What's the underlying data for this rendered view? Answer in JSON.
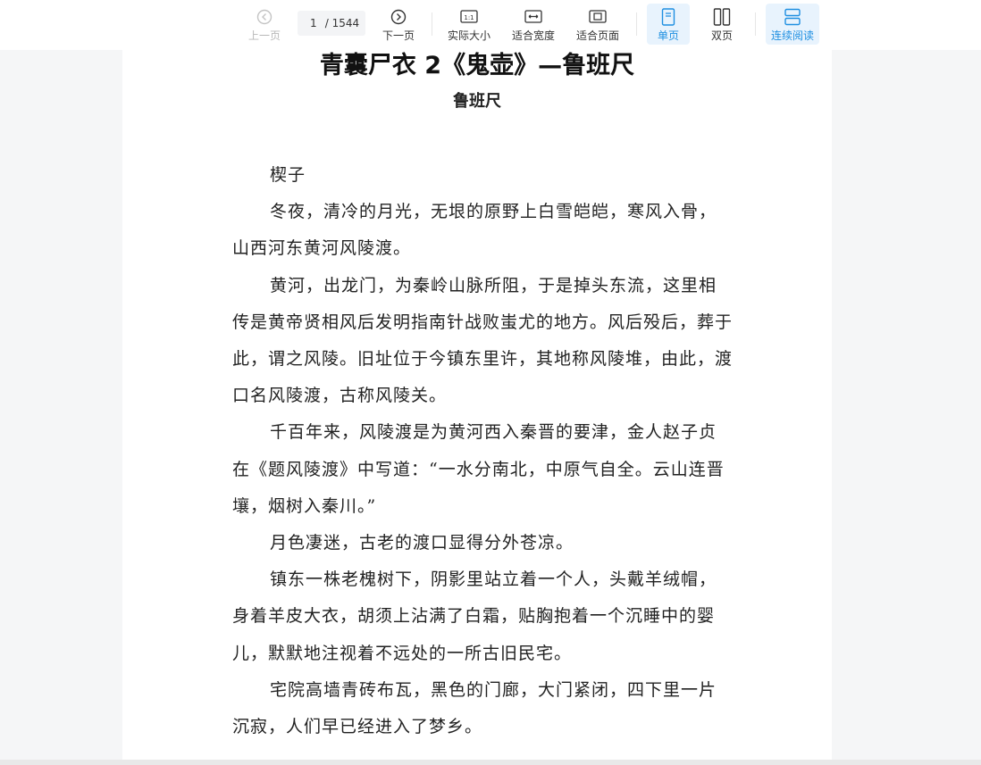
{
  "toolbar": {
    "prev_label": "上一页",
    "next_label": "下一页",
    "current_page": "1",
    "total_pages": "/ 1544",
    "actual_size_label": "实际大小",
    "fit_width_label": "适合宽度",
    "fit_page_label": "适合页面",
    "single_page_label": "单页",
    "double_page_label": "双页",
    "continuous_label": "连续阅读",
    "active_color": "#1e8fe1"
  },
  "document": {
    "title": "青囊尸衣 2《鬼壶》—鲁班尺",
    "author": "鲁班尺",
    "paragraphs": [
      "楔子",
      "冬夜，清冷的月光，无垠的原野上白雪皑皑，寒风入骨，山西河东黄河风陵渡。",
      "黄河，出龙门，为秦岭山脉所阻，于是掉头东流，这里相传是黄帝贤相风后发明指南针战败蚩尤的地方。风后殁后，葬于此，谓之风陵。旧址位于今镇东里许，其地称风陵堆，由此，渡口名风陵渡，古称风陵关。",
      "千百年来，风陵渡是为黄河西入秦晋的要津，金人赵子贞在《题风陵渡》中写道：“一水分南北，中原气自全。云山连晋壤，烟树入秦川。”",
      "月色凄迷，古老的渡口显得分外苍凉。",
      "镇东一株老槐树下，阴影里站立着一个人，头戴羊绒帽，身着羊皮大衣，胡须上沾满了白霜，贴胸抱着一个沉睡中的婴儿，默默地注视着不远处的一所古旧民宅。",
      "宅院高墙青砖布瓦，黑色的门廊，大门紧闭，四下里一片沉寂，人们早已经进入了梦乡。"
    ]
  }
}
